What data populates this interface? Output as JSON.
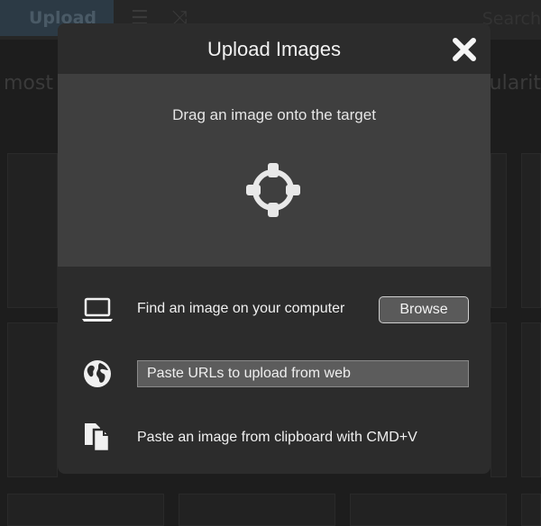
{
  "background": {
    "upload_label": "Upload",
    "search_label": "Search",
    "sort_left": "most",
    "sort_right": "ularit"
  },
  "modal": {
    "title": "Upload Images",
    "drop_text": "Drag an image onto the target",
    "computer_label": "Find an image on your computer",
    "browse_label": "Browse",
    "url_placeholder": "Paste URLs to upload from web",
    "clipboard_label": "Paste an image from clipboard with CMD+V"
  },
  "icons": {
    "close": "close-icon",
    "target": "crosshair-target-icon",
    "computer": "laptop-icon",
    "web": "globe-icon",
    "clipboard": "paste-documents-icon"
  },
  "colors": {
    "modal_bg": "#2c2c2c",
    "drop_zone_bg": "#3f3f3f",
    "text": "#f0f0f0"
  }
}
